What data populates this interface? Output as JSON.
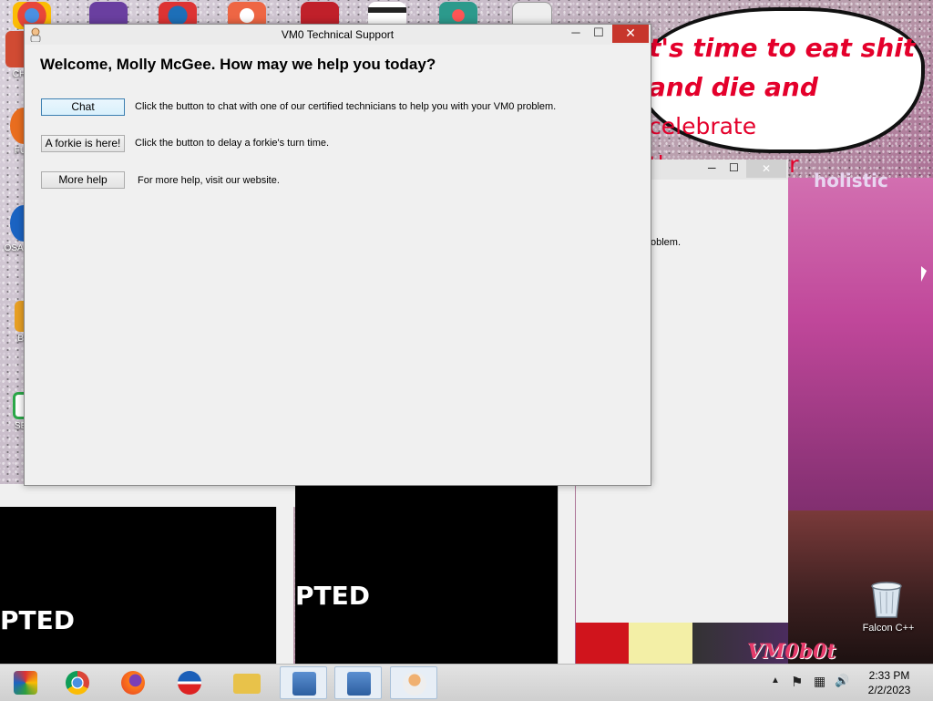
{
  "desktop": {
    "icons": [
      {
        "name": "chrome-shortcut",
        "label": "CH D",
        "color": "#d14b33"
      },
      {
        "name": "firefox-shortcut",
        "label": "FUR",
        "color": "#e96d1f"
      },
      {
        "name": "opera-shortcut",
        "label": "OSA LAD",
        "color": "#1b63c2"
      },
      {
        "name": "bee-shortcut",
        "label": "BE",
        "color": "#e8a024"
      },
      {
        "name": "sex-shortcut",
        "label": "SEX",
        "color": "#2aa748"
      }
    ],
    "recycle_bin_label": "Falcon C++"
  },
  "wallpaper": {
    "bubble_line1": "t's time to eat shit",
    "bubble_line2_bold": "and die and",
    "bubble_line2_plain": "celebrate",
    "bubble_line3": "the new year",
    "watermark_top": "holistic",
    "watermark_bottom": "VM0b0t"
  },
  "background_windows": {
    "left_caption": "PTED",
    "middle_caption": "PTED",
    "right_snippet": "oblem."
  },
  "dialog": {
    "title": "VM0 Technical Support",
    "minimize_label": "─",
    "maximize_label": "☐",
    "close_label": "✕",
    "welcome": "Welcome, Molly McGee. How may we help you today?",
    "actions": [
      {
        "button": "Chat",
        "description": "Click the button to chat with one of our certified technicians to help you with your VM0 problem."
      },
      {
        "button": "A forkie is here!",
        "description": "Click the button to delay a forkie's turn time."
      },
      {
        "button": "More help",
        "description": "For more help, visit our website."
      }
    ]
  },
  "taskbar": {
    "items": [
      {
        "name": "taskbar-rainbow-app",
        "color": "#2f9e3e"
      },
      {
        "name": "taskbar-chrome",
        "color": "#db4437"
      },
      {
        "name": "taskbar-firefox",
        "color": "#ff7a18"
      },
      {
        "name": "taskbar-obama-app",
        "color": "#1b5fb8"
      },
      {
        "name": "taskbar-file-explorer",
        "color": "#e8c24a"
      },
      {
        "name": "taskbar-setup-1",
        "color": "#5b8fd1"
      },
      {
        "name": "taskbar-setup-2",
        "color": "#5b8fd1"
      },
      {
        "name": "taskbar-tech-support",
        "color": "#f0b070"
      }
    ],
    "clock_time": "2:33 PM",
    "clock_date": "2/2/2023",
    "tray": {
      "chevron": "▲",
      "flag": "⚑",
      "network": "▦",
      "volume": "🔊"
    }
  },
  "colors": {
    "close_button": "#c7362c",
    "bubble_text": "#e4002b"
  }
}
